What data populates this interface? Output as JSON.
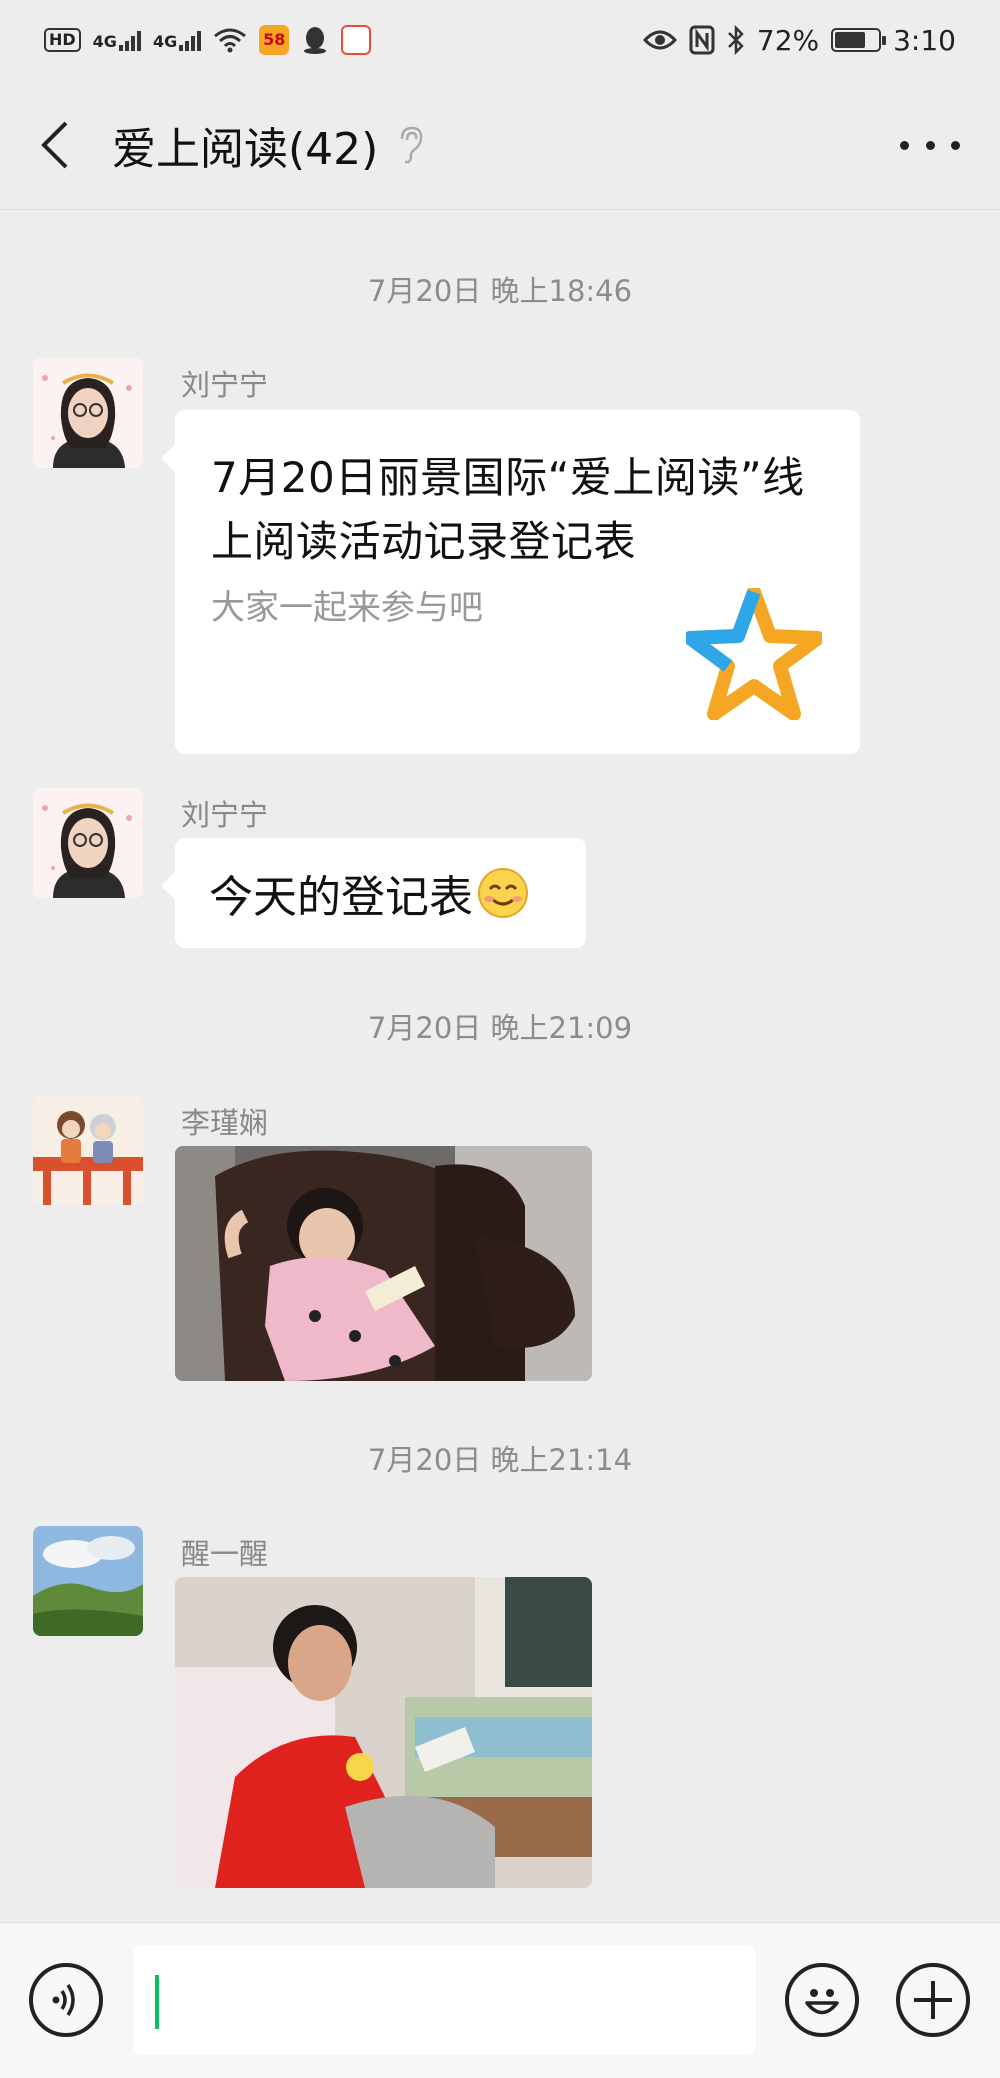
{
  "status_bar": {
    "hd_tag": "HD",
    "sim_tag": "1",
    "net1": "4G",
    "net2": "4G",
    "app58_label": "58",
    "battery_percent_text": "72%",
    "battery_level": 0.72,
    "time": "3:10"
  },
  "header": {
    "title": "爱上阅读(42)"
  },
  "messages": [
    {
      "type": "timestamp",
      "text": "7月20日 晚上18:46"
    },
    {
      "type": "card",
      "sender": "刘宁宁",
      "title": "7月20日丽景国际“爱上阅读”线上阅读活动记录登记表",
      "description": "大家一起来参与吧",
      "icon": "star-icon"
    },
    {
      "type": "text",
      "sender": "刘宁宁",
      "text": "今天的登记表",
      "emoji": "smiling-face-icon"
    },
    {
      "type": "timestamp",
      "text": "7月20日 晚上21:09"
    },
    {
      "type": "image",
      "sender": "李瑾娴",
      "image": "girl-reading-photo"
    },
    {
      "type": "timestamp",
      "text": "7月20日 晚上21:14"
    },
    {
      "type": "image",
      "sender": "醒一醒",
      "image": "boy-reading-photo"
    }
  ],
  "input_bar": {
    "voice_icon": "voice-icon",
    "emoji_icon": "emoji-icon",
    "plus_icon": "plus-icon",
    "input_value": ""
  },
  "colors": {
    "background": "#ededed",
    "bubble": "#ffffff",
    "caret": "#07c160",
    "timestamp": "#8c8c8c"
  }
}
